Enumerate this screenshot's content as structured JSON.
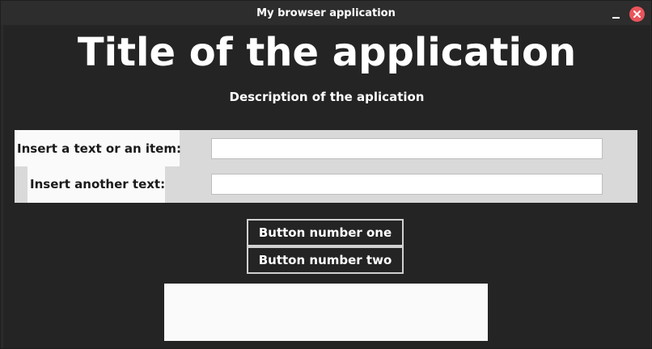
{
  "window": {
    "title": "My browser application"
  },
  "app": {
    "title": "Title of the application",
    "description": "Description of the aplication"
  },
  "form": {
    "field1": {
      "label": "Insert a text or an item:",
      "value": ""
    },
    "field2": {
      "label": "Insert another text:",
      "value": ""
    }
  },
  "buttons": {
    "one": "Button number one",
    "two": "Button number two"
  },
  "icons": {
    "minimize": "minimize-icon",
    "close": "close-icon"
  },
  "colors": {
    "background": "#242424",
    "titlebar": "#2d2d2d",
    "form_panel": "#d9d9d9",
    "close_button": "#e9545b"
  }
}
